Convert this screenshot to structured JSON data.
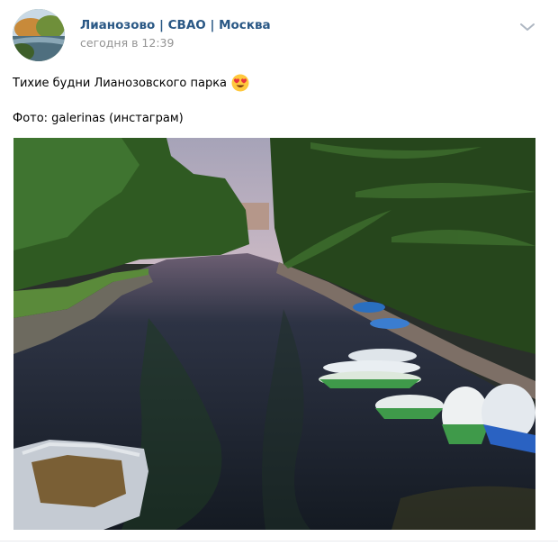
{
  "post": {
    "author": "Лианозово | СВАО | Москва",
    "time": "сегодня в 12:39",
    "text_line1": "Тихие будни Лианозовского парка",
    "text_line2": "Фото: galerinas (инстаграм)",
    "emoji": "heart-eyes-emoji",
    "more_icon": "chevron-down-icon"
  },
  "colors": {
    "author_link": "#2a5885",
    "meta_gray": "#939393",
    "water": "#1d2634",
    "foliage": "#2f5a22"
  }
}
